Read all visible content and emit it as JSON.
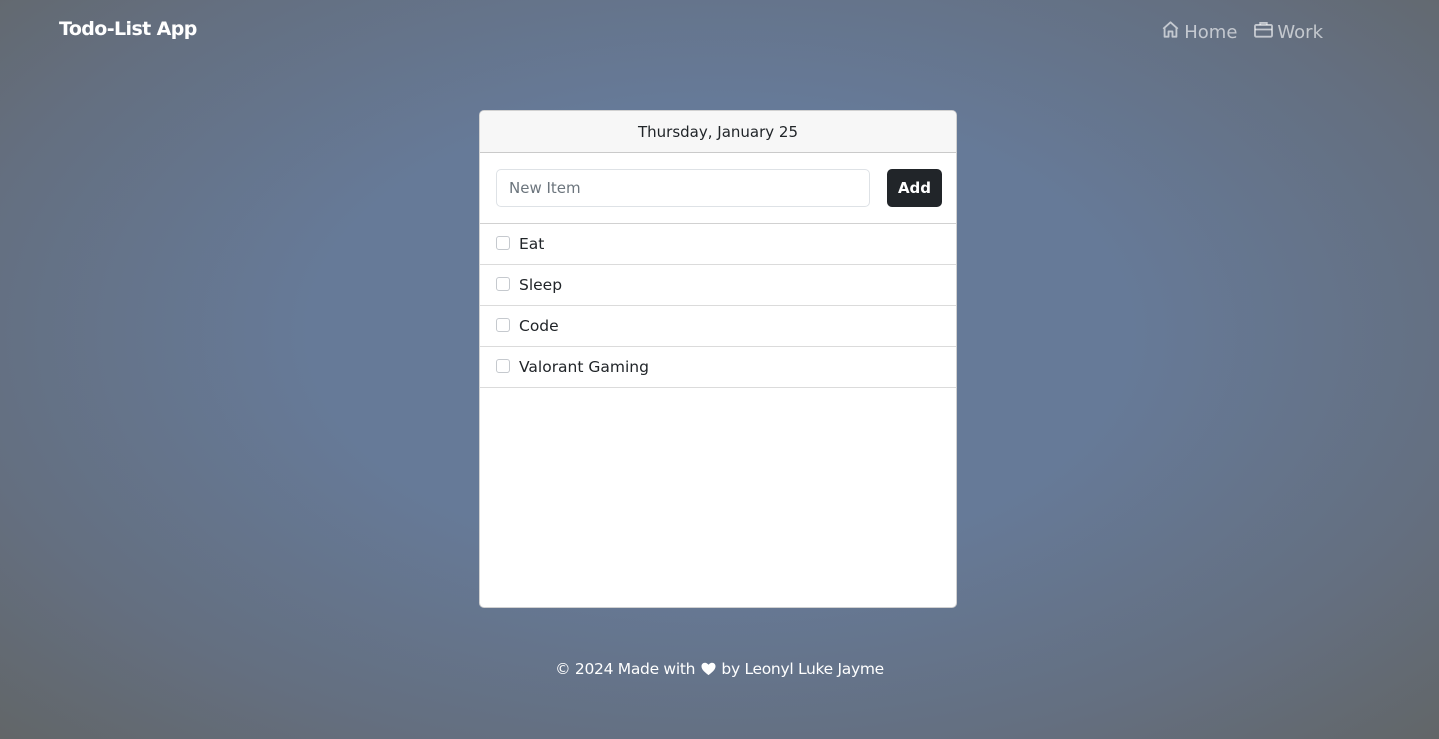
{
  "navbar": {
    "brand": "Todo-List App",
    "links": [
      {
        "label": "Home",
        "icon": "home-icon"
      },
      {
        "label": "Work",
        "icon": "briefcase-icon"
      }
    ]
  },
  "card": {
    "date_header": "Thursday, January 25",
    "new_item_placeholder": "New Item",
    "new_item_value": "",
    "add_label": "Add",
    "items": [
      {
        "label": "Eat",
        "checked": false
      },
      {
        "label": "Sleep",
        "checked": false
      },
      {
        "label": "Code",
        "checked": false
      },
      {
        "label": "Valorant Gaming",
        "checked": false
      }
    ]
  },
  "footer": {
    "prefix": "© 2024 Made with",
    "heart_icon": "heart-icon",
    "suffix": "by Leonyl Luke Jayme"
  },
  "colors": {
    "background": "#667a98",
    "button": "#212529",
    "text": "#ffffff"
  }
}
